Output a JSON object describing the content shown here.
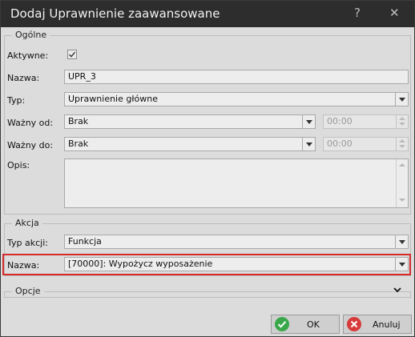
{
  "window": {
    "title": "Dodaj Uprawnienie zaawansowane",
    "help_label": "?",
    "close_label": "✕"
  },
  "general": {
    "legend": "Ogólne",
    "active_label": "Aktywne:",
    "active_checked": true,
    "name_label": "Nazwa:",
    "name_value": "UPR_3",
    "type_label": "Typ:",
    "type_value": "Uprawnienie główne",
    "valid_from_label": "Ważny od:",
    "valid_from_value": "Brak",
    "valid_from_time": "00:00",
    "valid_to_label": "Ważny do:",
    "valid_to_value": "Brak",
    "valid_to_time": "00:00",
    "description_label": "Opis:",
    "description_value": ""
  },
  "action": {
    "legend": "Akcja",
    "type_label": "Typ akcji:",
    "type_value": "Funkcja",
    "name_label": "Nazwa:",
    "name_value": "[70000]: Wypożycz wyposażenie"
  },
  "options": {
    "legend": "Opcje"
  },
  "buttons": {
    "ok_label": "OK",
    "cancel_label": "Anuluj"
  },
  "colors": {
    "highlight": "#d52b2b",
    "ok_icon": "#3aa84a",
    "cancel_icon": "#d83a3a"
  }
}
